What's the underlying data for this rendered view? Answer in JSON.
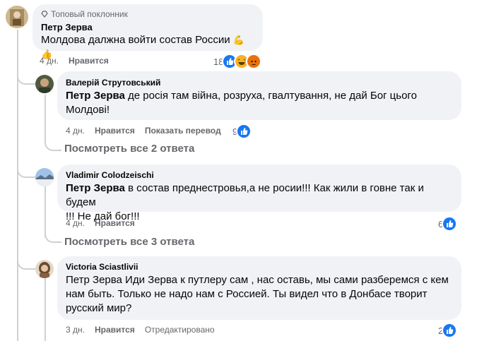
{
  "comment": {
    "badge": "Топовый поклонник",
    "author": "Петр Зерва",
    "text": "Молдова далжна войти состав России",
    "emoji": "💪👍",
    "time": "4 дн.",
    "like_label": "Нравится",
    "reactions_count": "18"
  },
  "replies": [
    {
      "author": "Валерій Струтовський",
      "mention": "Петр Зерва",
      "text_line1": " де росія там війна, розруха, гвалтування, не дай Бог цього",
      "text_line2": "Молдові!",
      "time": "4 дн.",
      "like_label": "Нравится",
      "extra_label": "Показать перевод",
      "reactions_count": "9",
      "view_replies": "Посмотреть все 2 ответа"
    },
    {
      "author": "Vladimir Colodzeischi",
      "mention": "Петр Зерва",
      "text_line1": " в состав преднестровья,а не росии!!! Как жили в говне так и будем",
      "text_line2": "!!! Не дай бог!!!",
      "time": "4 дн.",
      "like_label": "Нравится",
      "reactions_count": "6",
      "view_replies": "Посмотреть все 3 ответа"
    },
    {
      "author": "Victoria Sciastlivii",
      "text_line1": "Петр Зерва Иди Зерва к путлеру сам , нас оставь, мы сами разберемся с кем",
      "text_line2": "нам быть. Только не надо нам с Россией. Ты видел что в Донбасе творит",
      "text_line3": "русский мир?",
      "time": "3 дн.",
      "like_label": "Нравится",
      "extra_label": "Отредактировано",
      "reactions_count": "2"
    }
  ],
  "icons": {
    "badge_icon": "diamond-icon",
    "like_icon": "like-reaction-icon",
    "haha_icon": "haha-reaction-icon",
    "angry_icon": "angry-reaction-icon"
  }
}
